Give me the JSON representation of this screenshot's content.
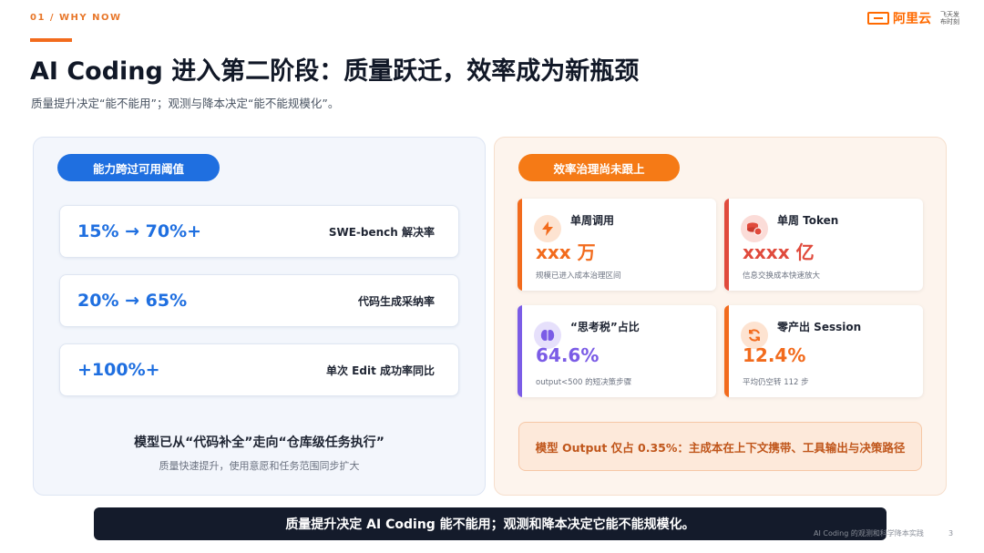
{
  "header": {
    "section_tag": "01 / WHY NOW",
    "title": "AI Coding 进入第二阶段：质量跃迁，效率成为新瓶颈",
    "subtitle": "质量提升决定“能不能用”；观测与降本决定“能不能规模化”。"
  },
  "logo": {
    "text": "阿里云",
    "sub": "飞天发布时刻"
  },
  "left_panel": {
    "pill": "能力跨过可用阈值",
    "metrics": [
      {
        "value": "15% → 70%+",
        "label": "SWE-bench 解决率"
      },
      {
        "value": "20% → 65%",
        "label": "代码生成采纳率"
      },
      {
        "value": "+100%+",
        "label": "单次 Edit 成功率同比"
      }
    ],
    "bottom_title": "模型已从“代码补全”走向“仓库级任务执行”",
    "bottom_sub": "质量快速提升，使用意愿和任务范围同步扩大"
  },
  "right_panel": {
    "pill": "效率治理尚未跟上",
    "stats": [
      {
        "title": "单周调用",
        "value": "xxx 万",
        "note": "规模已进入成本治理区间",
        "icon": "lightning-icon",
        "color": "#f26b1d"
      },
      {
        "title": "单周 Token",
        "value": "xxxx 亿",
        "note": "信息交换成本快速放大",
        "icon": "coins-icon",
        "color": "#e04a3c"
      },
      {
        "title": "“思考税”占比",
        "value": "64.6%",
        "note": "output<500 的短决策步骤",
        "icon": "brain-icon",
        "color": "#7b5ce6"
      },
      {
        "title": "零产出 Session",
        "value": "12.4%",
        "note": "平均仍空转 112 步",
        "icon": "refresh-icon",
        "color": "#f26b1d"
      }
    ],
    "callout": "模型 Output 仅占 0.35%：主成本在上下文携带、工具输出与决策路径"
  },
  "footer": {
    "banner": "质量提升决定 AI Coding 能不能用；观测和降本决定它能不能规模化。",
    "note": "AI Coding 的观测和科学降本实践",
    "page": "3"
  }
}
